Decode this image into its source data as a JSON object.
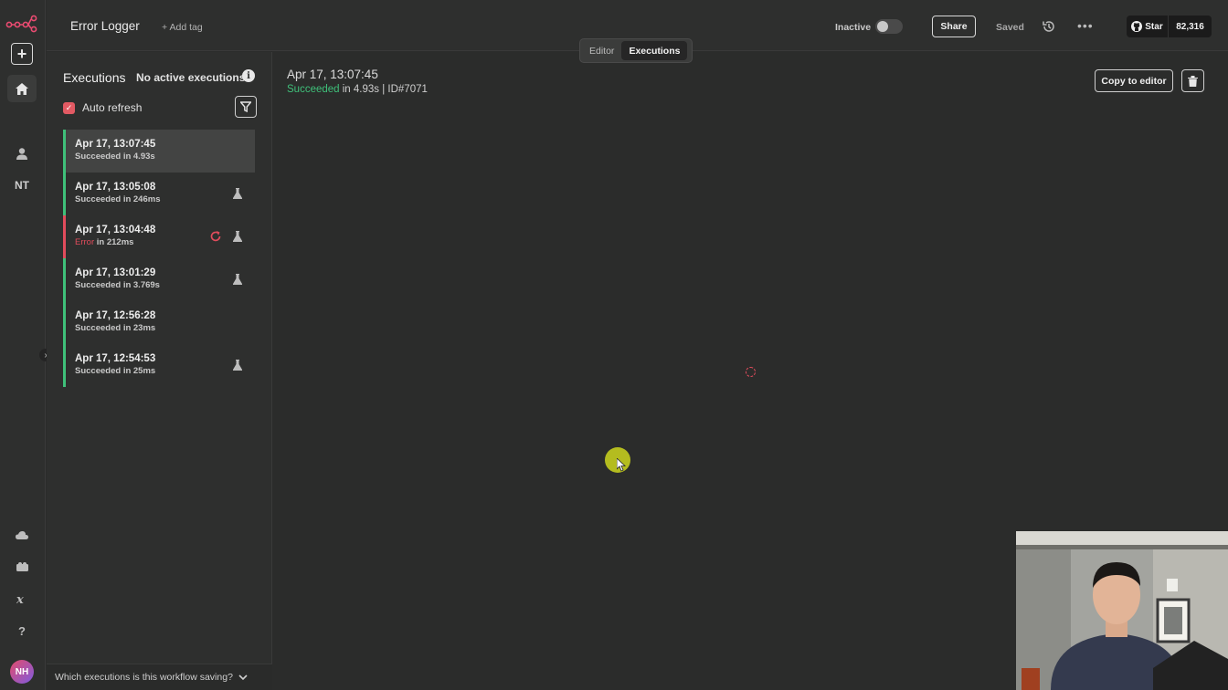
{
  "app": {
    "workflow_title": "Error Logger",
    "add_tag_label": "+ Add tag"
  },
  "rail": {
    "user_initials_label": "NT",
    "avatar_initials": "NH"
  },
  "header": {
    "status_label": "Inactive",
    "share_label": "Share",
    "saved_label": "Saved",
    "github": {
      "star_label": "Star",
      "star_count": "82,316"
    }
  },
  "tabs": [
    {
      "label": "Editor",
      "active": false
    },
    {
      "label": "Executions",
      "active": true
    }
  ],
  "executions_panel": {
    "title": "Executions",
    "no_active_label": "No active executions",
    "auto_refresh_label": "Auto refresh",
    "auto_refresh_checked": true,
    "items": [
      {
        "date": "Apr 17, 13:07:45",
        "status": "Succeeded",
        "duration": "in 4.93s",
        "selected": true,
        "flask": false,
        "retry": false
      },
      {
        "date": "Apr 17, 13:05:08",
        "status": "Succeeded",
        "duration": "in 246ms",
        "selected": false,
        "flask": true,
        "retry": false
      },
      {
        "date": "Apr 17, 13:04:48",
        "status": "Error",
        "duration": "in 212ms",
        "selected": false,
        "flask": true,
        "retry": true
      },
      {
        "date": "Apr 17, 13:01:29",
        "status": "Succeeded",
        "duration": "in 3.769s",
        "selected": false,
        "flask": true,
        "retry": false
      },
      {
        "date": "Apr 17, 12:56:28",
        "status": "Succeeded",
        "duration": "in 23ms",
        "selected": false,
        "flask": false,
        "retry": false
      },
      {
        "date": "Apr 17, 12:54:53",
        "status": "Succeeded",
        "duration": "in 25ms",
        "selected": false,
        "flask": true,
        "retry": false
      }
    ],
    "bottom_question": "Which executions is this workflow saving?"
  },
  "detail": {
    "date": "Apr 17, 13:07:45",
    "status": "Succeeded",
    "rest": " in 4.93s | ID#7071",
    "copy_label": "Copy to editor"
  },
  "colors": {
    "success": "#3fc07a",
    "error": "#e14c5c",
    "accent": "#e25a63"
  }
}
